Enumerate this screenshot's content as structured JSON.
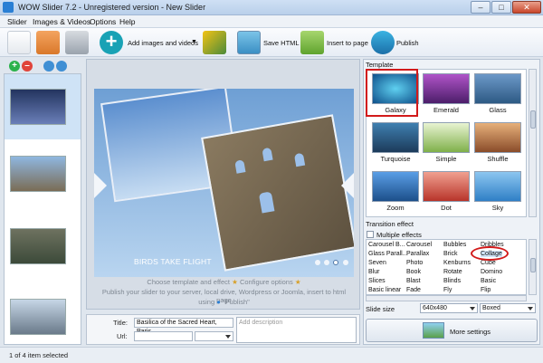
{
  "window": {
    "title": "WOW Slider 7.2 - Unregistered version - New Slider",
    "min": "–",
    "max": "□",
    "close": "✕"
  },
  "menu": [
    "Slider",
    "Images & Videos",
    "Options",
    "Help"
  ],
  "toolbar": {
    "add_images": "Add images and videos",
    "save_html": "Save HTML",
    "insert_to_page": "Insert to page",
    "publish": "Publish"
  },
  "left_tools": {
    "add": "+",
    "remove": "–"
  },
  "preview": {
    "caption": "BIRDS TAKE FLIGHT",
    "hint_line1": "Choose template and effect",
    "hint_line1b": "Configure options",
    "hint_line2": "Publish your slider to your server, local drive, Wordpress or Joomla, insert to html page",
    "hint_line3a": "using",
    "hint_line3b": "\"Publish\"",
    "dots_total": 4,
    "dots_active": 3
  },
  "props": {
    "title_label": "Title:",
    "title_value": "Basilica of the Sacred Heart, Paris",
    "url_label": "Url:",
    "description_placeholder": "Add description"
  },
  "template": {
    "label": "Template",
    "items": [
      {
        "name": "Galaxy",
        "color": "#1d86c6"
      },
      {
        "name": "Emerald",
        "color": "#7a3aa0"
      },
      {
        "name": "Glass",
        "color": "#4c7fb0"
      },
      {
        "name": "Turquoise",
        "color": "#2a5f8a"
      },
      {
        "name": "Simple",
        "color": "#cfe6a8"
      },
      {
        "name": "Shuffle",
        "color": "#c98a4e"
      },
      {
        "name": "Zoom",
        "color": "#2f72c6"
      },
      {
        "name": "Dot",
        "color": "#c84a3c"
      },
      {
        "name": "Sky",
        "color": "#4e9ad6"
      }
    ],
    "selected": "Galaxy"
  },
  "transition": {
    "label": "Transition effect",
    "multiple_label": "Multiple effects",
    "columns": [
      [
        "Carousel B...",
        "Glass Parall...",
        "Seven",
        "Blur",
        "Slices",
        "Basic linear"
      ],
      [
        "Carousel",
        "Parallax",
        "Photo",
        "Book",
        "Blast",
        "Fade"
      ],
      [
        "Bubbles",
        "Brick",
        "Kenburns",
        "Rotate",
        "Blinds",
        "Fly"
      ],
      [
        "Dribbles",
        "Collage",
        "Cube",
        "Domino",
        "Basic",
        "Flip"
      ]
    ],
    "highlighted": "Collage"
  },
  "slide_size": {
    "label": "Slide size",
    "value": "640x480",
    "mode": "Boxed"
  },
  "more_settings": "More settings",
  "status": "1 of 4 item selected",
  "colors": {
    "accent": "#2a7fd4",
    "highlight": "#d21a1a",
    "add": "#2bb24c",
    "remove": "#e0433a"
  }
}
